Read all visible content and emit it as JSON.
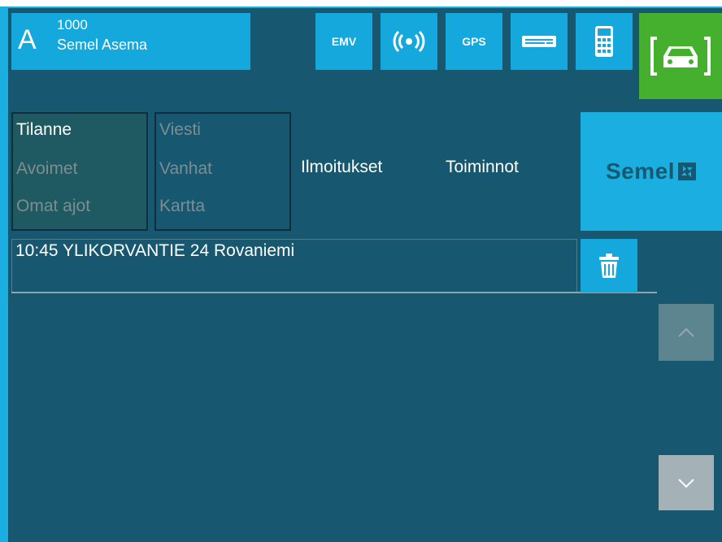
{
  "status": {
    "letter": "A",
    "number": "1000",
    "name": "Semel Asema"
  },
  "toolbar": {
    "emv_label": "EMV",
    "gps_label": "GPS",
    "icons": [
      "wireless-icon",
      "keyboard-icon",
      "calculator-icon",
      "taxi-icon"
    ]
  },
  "tabs": {
    "group1": [
      "Tilanne",
      "Avoimet",
      "Omat ajot"
    ],
    "group2": [
      "Viesti",
      "Vanhat",
      "Kartta"
    ],
    "notifications": "Ilmoitukset",
    "actions": "Toiminnot"
  },
  "logo": {
    "text": "Semel"
  },
  "list": {
    "row1": "10:45 YLIKORVANTIE 24 Rovaniemi"
  },
  "colors": {
    "accent": "#14a8dc",
    "panel": "#175870",
    "taxi_active": "#44b02e"
  }
}
